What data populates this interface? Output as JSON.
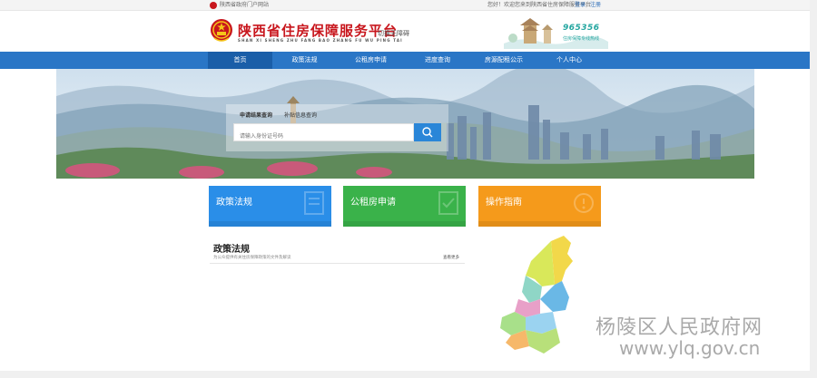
{
  "topbar": {
    "portal": "陕西省政府门户网站",
    "welcome": "您好！欢迎您来到陕西省住房保障服务平台",
    "login": "登录",
    "register": "注册"
  },
  "header": {
    "title": "陕西省住房保障服务平台",
    "pinyin": "SHAN XI SHENG ZHU FANG BAO ZHANG FU WU PING TAI",
    "switch": "切换无障碍",
    "hotline": "965356",
    "hotline_sub": "住房保障专线热线"
  },
  "nav": {
    "items": [
      {
        "label": "首页",
        "active": true
      },
      {
        "label": "政策法规",
        "active": false
      },
      {
        "label": "公租房申请",
        "active": false
      },
      {
        "label": "进度查询",
        "active": false
      },
      {
        "label": "房源配租公示",
        "active": false
      },
      {
        "label": "个人中心",
        "active": false
      }
    ]
  },
  "search": {
    "tab_progress": "申请结果查询",
    "tab_other": "补贴信息查询",
    "placeholder": "请输入身份证号码"
  },
  "cards": [
    {
      "label": "政策法规",
      "color": "#2a8ee8"
    },
    {
      "label": "公租房申请",
      "color": "#3ab24a"
    },
    {
      "label": "操作指南",
      "color": "#f59a1b"
    }
  ],
  "policy": {
    "title": "政策法规",
    "subtitle": "为公众提供有关住房保障政策的文件及解读",
    "more": "查看更多"
  },
  "watermark": {
    "line1": "杨陵区人民政府网",
    "line2": "www.ylq.gov.cn"
  },
  "colors": {
    "brand_red": "#c8161d",
    "nav_blue": "#2a76c6",
    "accent_teal": "#23a6a0"
  }
}
